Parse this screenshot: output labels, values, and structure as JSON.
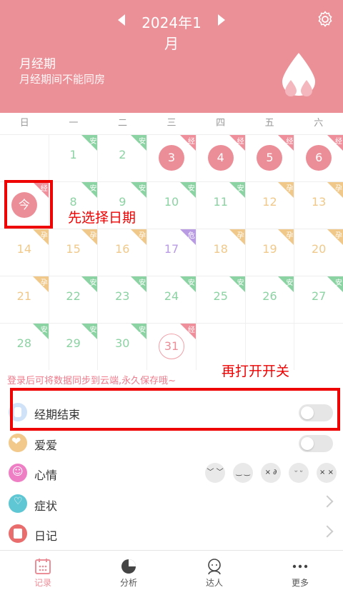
{
  "header": {
    "month": "2024年1月",
    "period_title": "月经期",
    "period_subtitle": "月经期间不能同房"
  },
  "weekdays": [
    "日",
    "一",
    "二",
    "三",
    "四",
    "五",
    "六"
  ],
  "colors": {
    "brand": "#ec9098",
    "safe": "#8cd3a3",
    "pregnancy": "#f0c98a",
    "period": "#ef8f9b",
    "danger": "#b99be3"
  },
  "calendar": {
    "rows": [
      [
        {
          "day": ""
        },
        {
          "day": "1",
          "tag": "安",
          "tagType": "safe",
          "color": "safe"
        },
        {
          "day": "2",
          "tag": "安",
          "tagType": "safe",
          "color": "safe"
        },
        {
          "day": "3",
          "tag": "经",
          "tagType": "period",
          "circle": "filled"
        },
        {
          "day": "4",
          "tag": "经",
          "tagType": "period",
          "circle": "filled"
        },
        {
          "day": "5",
          "tag": "经",
          "tagType": "period",
          "circle": "filled"
        },
        {
          "day": "6",
          "tag": "经",
          "tagType": "period",
          "circle": "filled"
        }
      ],
      [
        {
          "day": "今",
          "tag": "经",
          "tagType": "period",
          "circle": "filled"
        },
        {
          "day": "8",
          "tag": "安",
          "tagType": "safe",
          "color": "safe"
        },
        {
          "day": "9",
          "tag": "安",
          "tagType": "safe",
          "color": "safe"
        },
        {
          "day": "10",
          "tag": "安",
          "tagType": "safe",
          "color": "safe"
        },
        {
          "day": "11",
          "tag": "安",
          "tagType": "safe",
          "color": "safe"
        },
        {
          "day": "12",
          "tag": "孕",
          "tagType": "pregnancy",
          "color": "pregnancy"
        },
        {
          "day": "13",
          "tag": "孕",
          "tagType": "pregnancy",
          "color": "pregnancy"
        }
      ],
      [
        {
          "day": "14",
          "tag": "孕",
          "tagType": "pregnancy",
          "color": "pregnancy"
        },
        {
          "day": "15",
          "tag": "孕",
          "tagType": "pregnancy",
          "color": "pregnancy"
        },
        {
          "day": "16",
          "tag": "孕",
          "tagType": "pregnancy",
          "color": "pregnancy"
        },
        {
          "day": "17",
          "tag": "危",
          "tagType": "danger",
          "color": "danger"
        },
        {
          "day": "18",
          "tag": "孕",
          "tagType": "pregnancy",
          "color": "pregnancy"
        },
        {
          "day": "19",
          "tag": "孕",
          "tagType": "pregnancy",
          "color": "pregnancy"
        },
        {
          "day": "20",
          "tag": "孕",
          "tagType": "pregnancy",
          "color": "pregnancy"
        }
      ],
      [
        {
          "day": "21",
          "tag": "孕",
          "tagType": "pregnancy",
          "color": "pregnancy"
        },
        {
          "day": "22",
          "tag": "安",
          "tagType": "safe",
          "color": "safe"
        },
        {
          "day": "23",
          "tag": "安",
          "tagType": "safe",
          "color": "safe"
        },
        {
          "day": "24",
          "tag": "安",
          "tagType": "safe",
          "color": "safe"
        },
        {
          "day": "25",
          "tag": "安",
          "tagType": "safe",
          "color": "safe"
        },
        {
          "day": "26",
          "tag": "安",
          "tagType": "safe",
          "color": "safe"
        },
        {
          "day": "27",
          "tag": "安",
          "tagType": "safe",
          "color": "safe"
        }
      ],
      [
        {
          "day": "28",
          "tag": "安",
          "tagType": "safe",
          "color": "safe"
        },
        {
          "day": "29",
          "tag": "安",
          "tagType": "safe",
          "color": "safe"
        },
        {
          "day": "30",
          "tag": "安",
          "tagType": "safe",
          "color": "safe"
        },
        {
          "day": "31",
          "tag": "经",
          "tagType": "period",
          "circle": "outline"
        },
        {
          "day": ""
        },
        {
          "day": ""
        },
        {
          "day": ""
        }
      ]
    ]
  },
  "annotations": {
    "step1": "先选择日期",
    "step2": "再打开开关"
  },
  "login_hint": "登录后可将数据同步到云端,永久保存哦~",
  "menu": {
    "period_end": "经期结束",
    "love": "爱爱",
    "mood": "心情",
    "symptom": "症状",
    "diary": "日记"
  },
  "mood_faces": [
    "﹀ ﹀",
    "‿ ‿",
    "× ∂",
    "ᵕ ᵕ",
    "× ×"
  ],
  "tabs": [
    "记录",
    "分析",
    "达人",
    "更多"
  ]
}
